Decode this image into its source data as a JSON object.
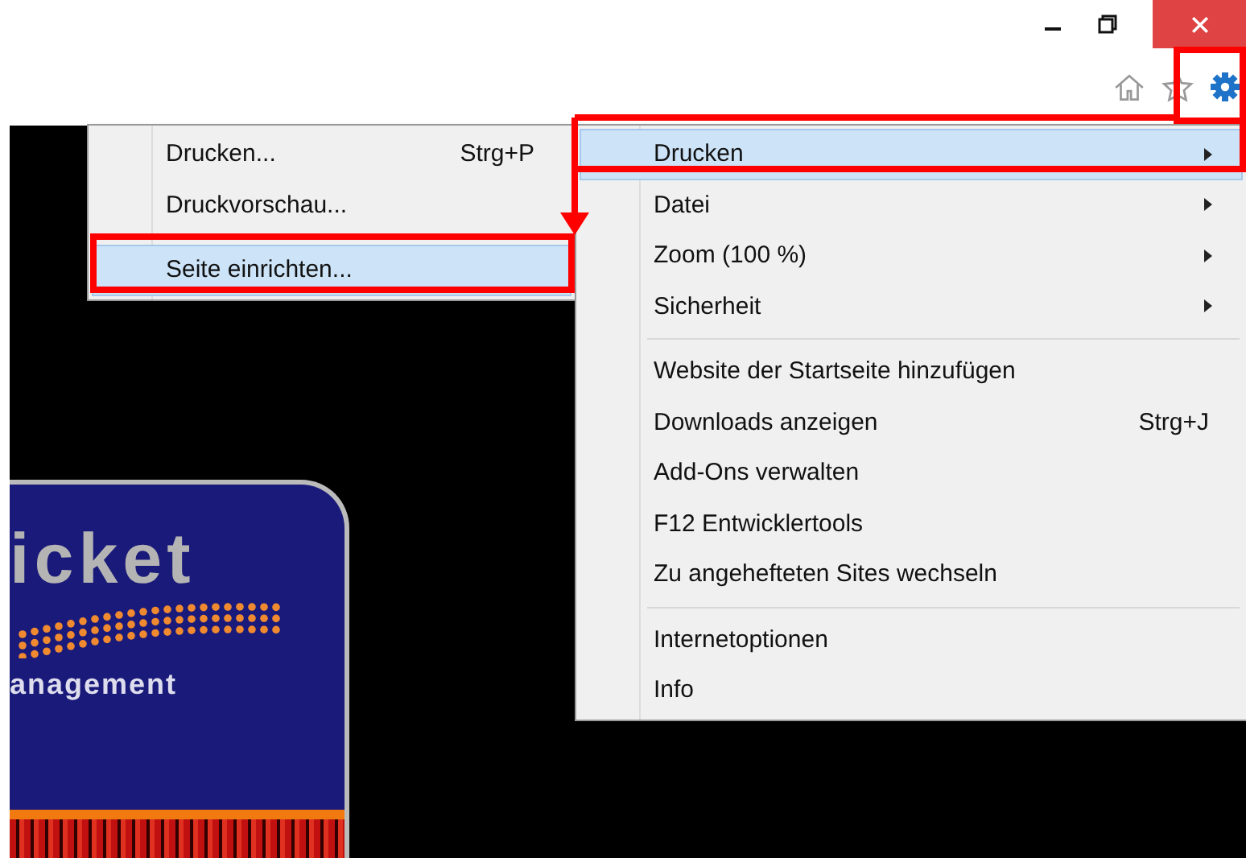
{
  "print_submenu": {
    "groups": [
      [
        {
          "label": "Drucken...",
          "shortcut": "Strg+P",
          "selected": false
        },
        {
          "label": "Druckvorschau...",
          "selected": false
        }
      ],
      [
        {
          "label": "Seite einrichten...",
          "selected": true
        }
      ]
    ]
  },
  "tools_menu": {
    "groups": [
      [
        {
          "label": "Drucken",
          "has_submenu": true,
          "selected": true
        },
        {
          "label": "Datei",
          "has_submenu": true,
          "selected": false
        },
        {
          "label": "Zoom (100 %)",
          "has_submenu": true,
          "selected": false
        },
        {
          "label": "Sicherheit",
          "has_submenu": true,
          "selected": false
        }
      ],
      [
        {
          "label": "Website der Startseite hinzufügen",
          "has_submenu": false,
          "selected": false
        },
        {
          "label": "Downloads anzeigen",
          "shortcut": "Strg+J",
          "has_submenu": false,
          "selected": false
        },
        {
          "label": "Add-Ons verwalten",
          "has_submenu": false,
          "selected": false
        },
        {
          "label": "F12 Entwicklertools",
          "has_submenu": false,
          "selected": false
        },
        {
          "label": "Zu angehefteten Sites wechseln",
          "has_submenu": false,
          "selected": false
        }
      ],
      [
        {
          "label": "Internetoptionen",
          "has_submenu": false,
          "selected": false
        },
        {
          "label": "Info",
          "has_submenu": false,
          "selected": false
        }
      ]
    ]
  },
  "logo": {
    "title": "icket",
    "subtitle": "anagement"
  }
}
